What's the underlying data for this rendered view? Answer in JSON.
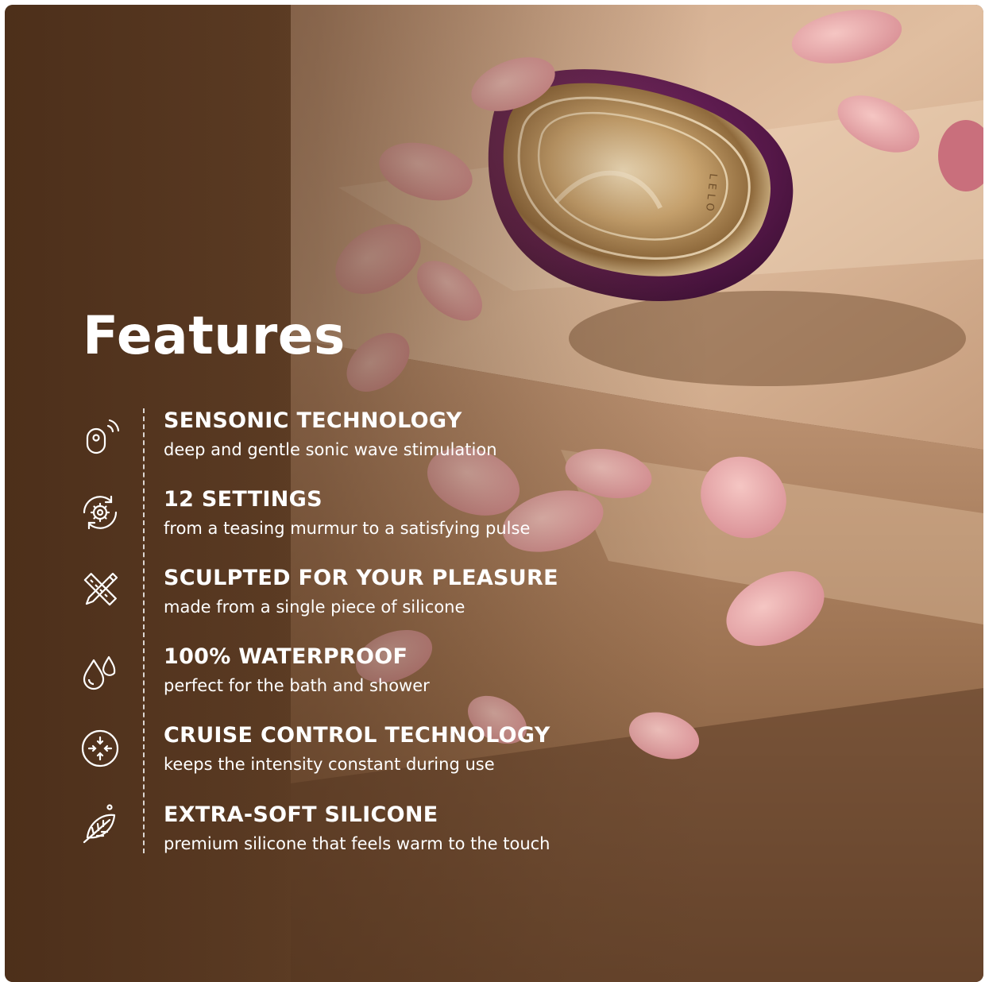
{
  "heading": "Features",
  "brand_mark": "LELO",
  "colors": {
    "product_purple": "#5a1a4e",
    "product_gold": "#d9b98a",
    "table_surface": "#d9b596",
    "petal_pink": "#e8a9aa",
    "panel_brown": "#6b4428"
  },
  "features": [
    {
      "icon": "sonic-wave-icon",
      "title": "SENSONIC TECHNOLOGY",
      "description": "deep and gentle sonic wave stimulation"
    },
    {
      "icon": "settings-gear-icon",
      "title": "12 SETTINGS",
      "description": "from a teasing murmur to a satisfying pulse"
    },
    {
      "icon": "ruler-pencil-icon",
      "title": "SCULPTED FOR YOUR PLEASURE",
      "description": "made from a single piece of silicone"
    },
    {
      "icon": "water-drops-icon",
      "title": "100% WATERPROOF",
      "description": "perfect for the bath and shower"
    },
    {
      "icon": "cruise-control-icon",
      "title": "CRUISE CONTROL TECHNOLOGY",
      "description": "keeps the intensity constant during use"
    },
    {
      "icon": "feather-leaf-icon",
      "title": "EXTRA-SOFT SILICONE",
      "description": "premium silicone that feels warm to the touch"
    }
  ]
}
